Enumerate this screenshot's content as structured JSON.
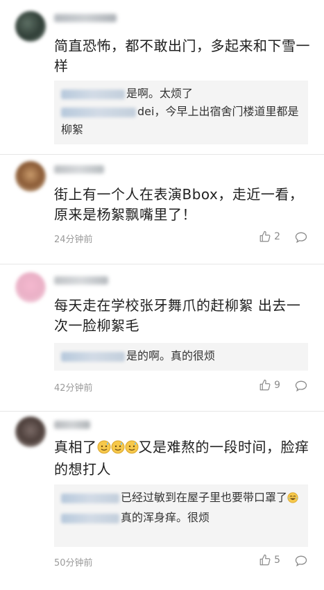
{
  "comments": [
    {
      "text": "简直恐怖，都不敢出门，多起来和下雪一样",
      "replies": [
        {
          "text": "是啊。太烦了"
        },
        {
          "text": "dei，今早上出宿舍门楼道里都是柳絮"
        }
      ]
    },
    {
      "text": "街上有一个人在表演Bbox，走近一看，原来是杨絮飘嘴里了！",
      "time": "24分钟前",
      "likes": "2"
    },
    {
      "text": "每天走在学校张牙舞爪的赶柳絮 出去一次一脸柳絮毛",
      "replies": [
        {
          "text": "是的啊。真的很烦"
        }
      ],
      "time": "42分钟前",
      "likes": "9"
    },
    {
      "text_a": "真相了",
      "text_b": "又是难熬的一段时间，脸痒的想打人",
      "replies": [
        {
          "text_a": "已经过敏到在屋子里也要带口罩",
          "text_b": "了"
        },
        {
          "text": "真的浑身痒。很烦"
        }
      ],
      "time": "50分钟前",
      "likes": "5"
    }
  ],
  "icons": {
    "like": "thumbs-up-icon",
    "comment": "comment-bubble-icon",
    "emoji_sweat": "sweat-smile-emoji-icon",
    "emoji_laugh": "tears-of-joy-emoji-icon"
  },
  "colors": {
    "reply_bg": "#f4f4f4",
    "meta": "#9a9a9a",
    "divider": "#e6e6e6"
  }
}
